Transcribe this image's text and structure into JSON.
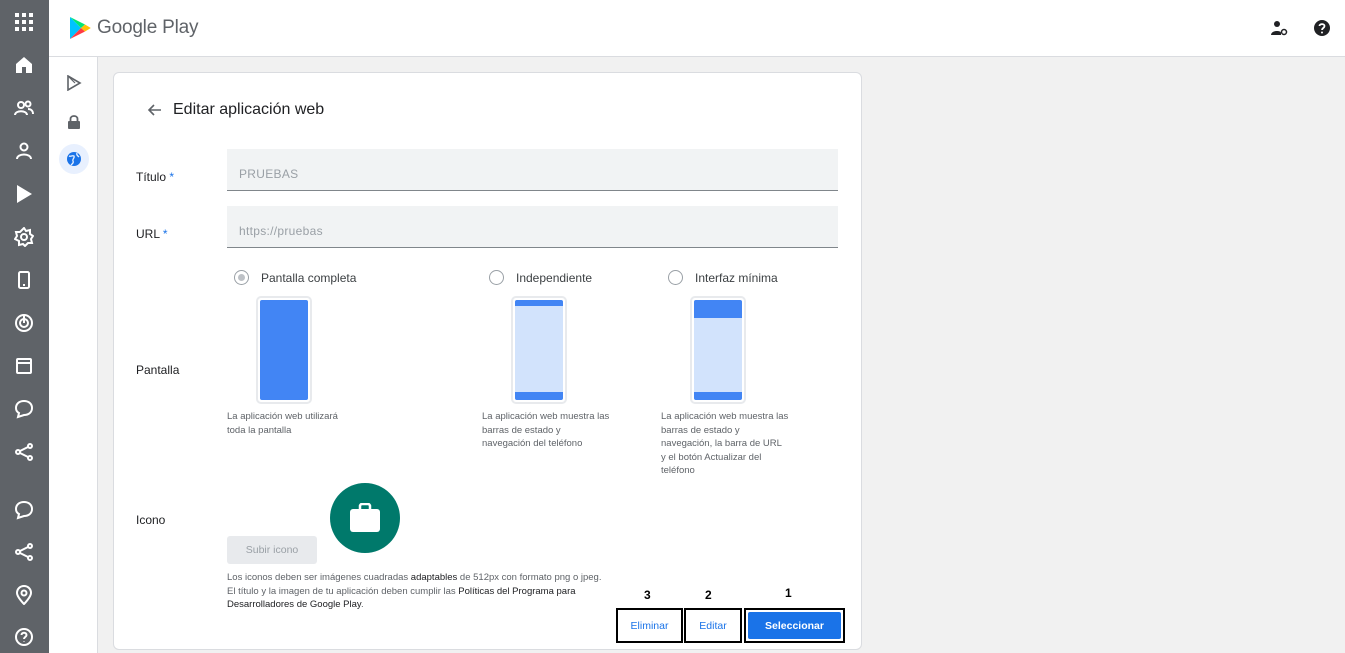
{
  "app": {
    "name": "Google Play"
  },
  "header": {
    "admin_icon": "admin-settings-icon",
    "help_icon": "help-icon"
  },
  "left_nav": [
    "apps-grid-icon",
    "home-icon",
    "users-icon",
    "person-icon",
    "play-icon",
    "settings-icon",
    "device-icon",
    "target-icon",
    "calendar-icon",
    "chat-icon",
    "share-icon",
    "chat-icon",
    "share-icon",
    "location-icon",
    "help-circle-icon"
  ],
  "sub_nav": [
    "play-outline-icon",
    "lock-icon",
    "globe-icon"
  ],
  "page": {
    "title": "Editar aplicación web"
  },
  "form": {
    "title_label": "Título",
    "title_value": "PRUEBAS",
    "url_label": "URL",
    "url_value": "https://pruebas",
    "required_mark": "*",
    "display_label": "Pantalla",
    "icon_label": "Icono"
  },
  "display_options": [
    {
      "label": "Pantalla completa",
      "selected": true,
      "desc": [
        "La aplicación web utilizará",
        "toda la pantalla"
      ]
    },
    {
      "label": "Independiente",
      "selected": false,
      "desc": [
        "La aplicación web muestra las",
        "barras de estado y",
        "navegación del teléfono"
      ]
    },
    {
      "label": "Interfaz mínima",
      "selected": false,
      "desc": [
        "La aplicación web muestra las",
        "barras de estado y",
        "navegación, la barra de URL",
        "y el botón Actualizar del",
        "teléfono"
      ]
    }
  ],
  "icon": {
    "upload_label": "Subir icono",
    "note_1": "Los iconos deben ser imágenes cuadradas ",
    "note_link_1": "adaptables",
    "note_2": " de 512px con formato png o jpeg. El título y la imagen de tu aplicación deben cumplir las ",
    "note_link_2": "Políticas del Programa para Desarrolladores de Google Play",
    "note_3": ".",
    "preview_color": "#00796b"
  },
  "actions": {
    "delete_label": "Eliminar",
    "edit_label": "Editar",
    "select_label": "Seleccionar",
    "step_delete": "3",
    "step_edit": "2",
    "step_select": "1"
  },
  "colors": {
    "accent": "#1a73e8",
    "sidebar": "#5f6368"
  }
}
